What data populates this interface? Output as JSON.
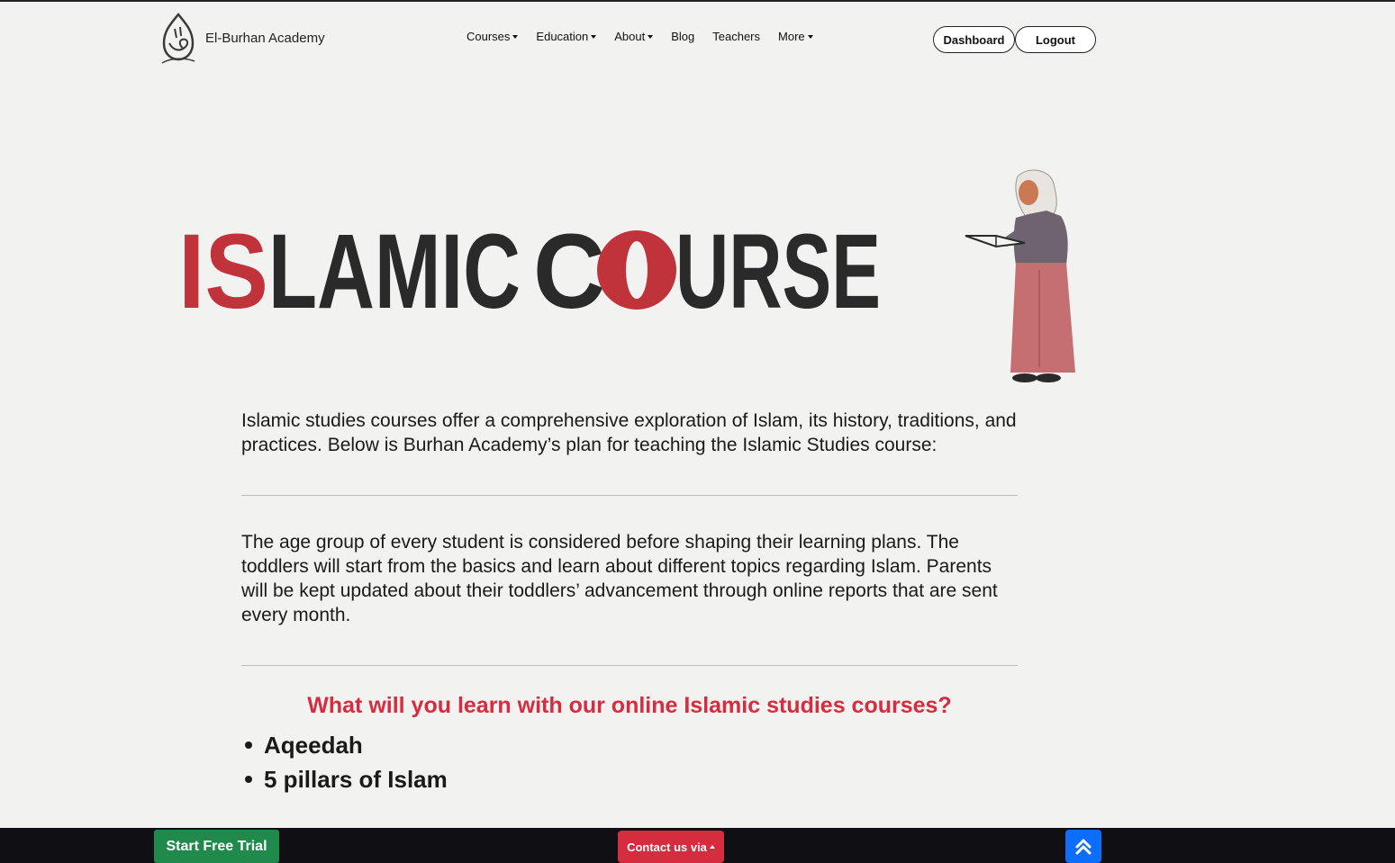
{
  "header": {
    "brand_name": "El-Burhan Academy",
    "nav": [
      {
        "label": "Courses",
        "has_dropdown": true
      },
      {
        "label": "Education",
        "has_dropdown": true
      },
      {
        "label": "About",
        "has_dropdown": true
      },
      {
        "label": "Blog",
        "has_dropdown": false
      },
      {
        "label": "Teachers",
        "has_dropdown": false
      },
      {
        "label": "More",
        "has_dropdown": true
      }
    ],
    "dashboard_label": "Dashboard",
    "logout_label": "Logout"
  },
  "hero": {
    "title_part1": "IS",
    "title_part2": "LAMIC",
    "title_part3": "C",
    "title_part4": "URSE",
    "accent_color": "#c0333b",
    "dark_color": "#2a2a2a"
  },
  "content": {
    "intro": "Islamic studies courses offer a comprehensive exploration of Islam, its history, traditions, and practices. Below is Burhan Academy’s plan for teaching the Islamic Studies course:",
    "age_paragraph": "The age group of every student is considered before shaping their learning plans. The toddlers will start from the basics and learn about different topics regarding Islam. Parents will be kept updated about their toddlers’ advancement through online reports that are sent every month.",
    "learn_title": "What will you learn with our online Islamic studies courses?",
    "learn_items": [
      "Aqeedah",
      "5 pillars of Islam"
    ]
  },
  "footer": {
    "trial_label": "Start Free Trial",
    "contact_label": "Contact us via",
    "scroll_top_icon": "double-chevron-up-icon"
  }
}
